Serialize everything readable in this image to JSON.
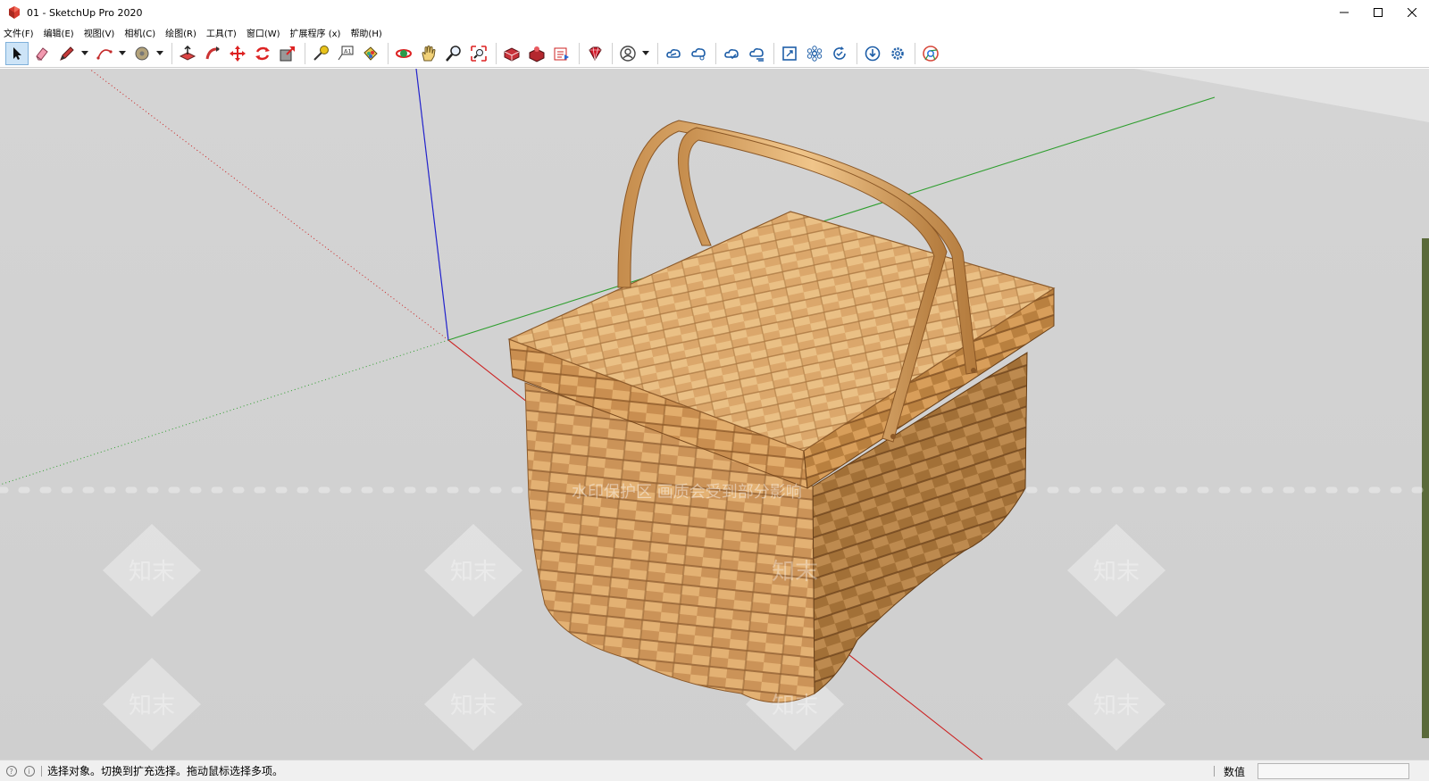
{
  "window": {
    "title": "01 - SketchUp Pro 2020"
  },
  "menu": {
    "items": [
      "文件(F)",
      "编辑(E)",
      "视图(V)",
      "相机(C)",
      "绘图(R)",
      "工具(T)",
      "窗口(W)",
      "扩展程序 (x)",
      "帮助(H)"
    ]
  },
  "toolbar": {
    "tools": [
      "select",
      "eraser",
      "line",
      "arc",
      "shape",
      "push-pull",
      "follow-me",
      "move",
      "rotate",
      "scale",
      "tape-measure",
      "text",
      "paint-bucket",
      "orbit",
      "pan",
      "zoom",
      "zoom-extents",
      "3d-warehouse",
      "extension-warehouse",
      "layout",
      "ruby",
      "profile",
      "cloud-1",
      "cloud-2",
      "cloud-3",
      "cloud-4",
      "frame",
      "components",
      "sync",
      "download",
      "settings",
      "chrome"
    ]
  },
  "viewport": {
    "watermark_text": "水印保护区 画质会受到部分影响",
    "watermark_brand": "知末"
  },
  "statusbar": {
    "hint": "选择对象。切换到扩充选择。拖动鼠标选择多项。",
    "measure_label": "数值",
    "measure_value": ""
  },
  "colors": {
    "sky": "#d3d3d3",
    "ground": "#c9c9c9",
    "wood_light": "#e8b87a",
    "wood_dark": "#b07a3e",
    "axis_red": "#cc2222",
    "axis_green": "#2e9e2e",
    "axis_blue": "#2222cc",
    "selection_highlight": "#cde4f7"
  }
}
